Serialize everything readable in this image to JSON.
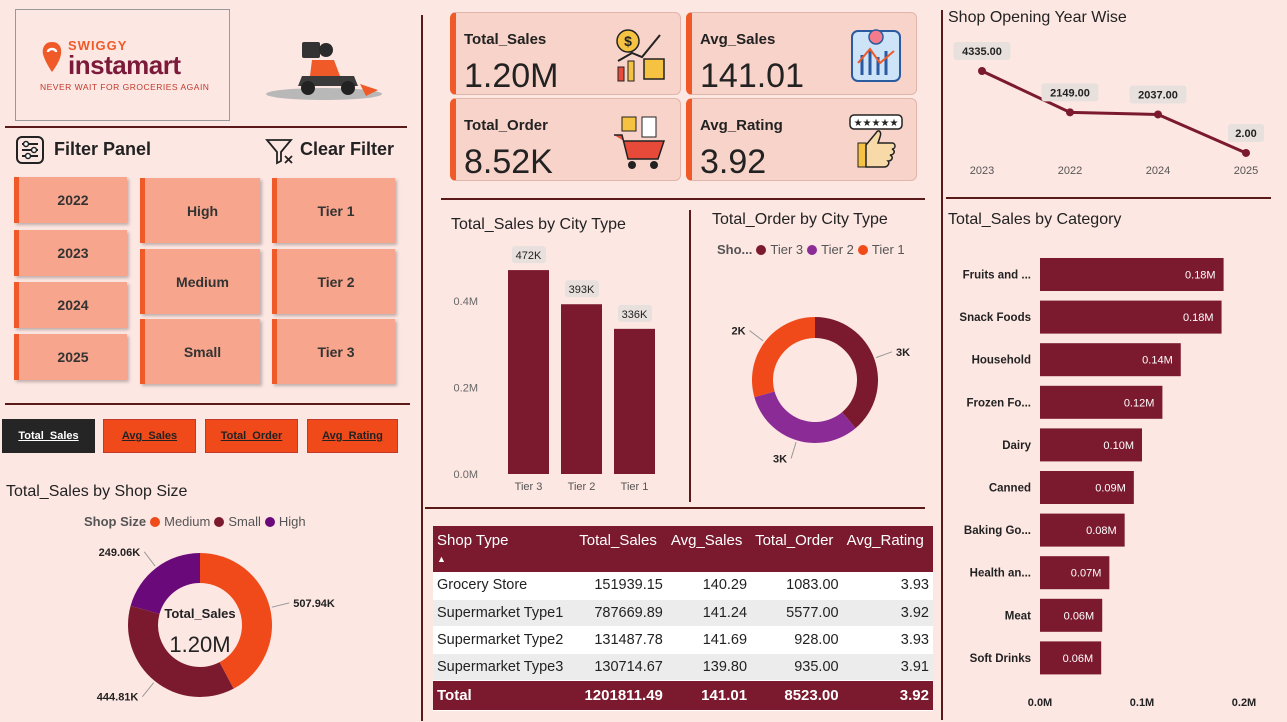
{
  "logo": {
    "brand_small": "SWIGGY",
    "brand_big": "instamart",
    "tagline": "NEVER WAIT FOR GROCERIES AGAIN"
  },
  "filters": {
    "title": "Filter Panel",
    "clear_label": "Clear Filter",
    "years": [
      "2022",
      "2023",
      "2024",
      "2025"
    ],
    "sizes": [
      "High",
      "Medium",
      "Small"
    ],
    "tiers": [
      "Tier 1",
      "Tier 2",
      "Tier 3"
    ]
  },
  "metric_tabs": [
    "Total_Sales",
    "Avg_Sales",
    "Total_Order",
    "Avg_Rating"
  ],
  "kpis": [
    {
      "label": "Total_Sales",
      "value": "1.20M",
      "icon": "money-growth-icon"
    },
    {
      "label": "Avg_Sales",
      "value": "141.01",
      "icon": "analytics-icon"
    },
    {
      "label": "Total_Order",
      "value": "8.52K",
      "icon": "shopping-cart-icon"
    },
    {
      "label": "Avg_Rating",
      "value": "3.92",
      "icon": "thumbs-up-rating-icon"
    }
  ],
  "shop_size_chart": {
    "title": "Total_Sales by Shop Size",
    "legend_title": "Shop Size",
    "center_label": "Total_Sales",
    "center_value": "1.20M",
    "chart_data": {
      "type": "pie",
      "series": [
        {
          "name": "Medium",
          "value": 507.94,
          "label": "507.94K",
          "color": "#f04a1a"
        },
        {
          "name": "Small",
          "value": 444.81,
          "label": "444.81K",
          "color": "#7b1a2e"
        },
        {
          "name": "High",
          "value": 249.06,
          "label": "249.06K",
          "color": "#6a0a7a"
        }
      ]
    }
  },
  "city_sales_chart": {
    "title": "Total_Sales by City Type",
    "chart_data": {
      "type": "bar",
      "categories": [
        "Tier 3",
        "Tier 2",
        "Tier 1"
      ],
      "values": [
        472,
        393,
        336
      ],
      "value_labels": [
        "472K",
        "393K",
        "336K"
      ],
      "y_ticks": [
        "0.0M",
        "0.2M",
        "0.4M"
      ],
      "ylim": [
        0,
        500
      ],
      "color": "#7b1a2e"
    }
  },
  "city_order_chart": {
    "title": "Total_Order by City Type",
    "legend_title": "Sho...",
    "chart_data": {
      "type": "pie",
      "series": [
        {
          "name": "Tier 3",
          "value": 3.3,
          "label": "3K",
          "color": "#7b1a2e"
        },
        {
          "name": "Tier 2",
          "value": 2.7,
          "label": "3K",
          "color": "#8b2c96"
        },
        {
          "name": "Tier 1",
          "value": 2.5,
          "label": "2K",
          "color": "#f04a1a"
        }
      ]
    }
  },
  "shop_table": {
    "columns": [
      "Shop Type",
      "Total_Sales",
      "Avg_Sales",
      "Total_Order",
      "Avg_Rating"
    ],
    "rows": [
      [
        "Grocery Store",
        "151939.15",
        "140.29",
        "1083.00",
        "3.93"
      ],
      [
        "Supermarket Type1",
        "787669.89",
        "141.24",
        "5577.00",
        "3.92"
      ],
      [
        "Supermarket Type2",
        "131487.78",
        "141.69",
        "928.00",
        "3.93"
      ],
      [
        "Supermarket Type3",
        "130714.67",
        "139.80",
        "935.00",
        "3.91"
      ]
    ],
    "total": [
      "Total",
      "1201811.49",
      "141.01",
      "8523.00",
      "3.92"
    ]
  },
  "year_chart": {
    "title": "Shop Opening Year Wise",
    "chart_data": {
      "type": "line",
      "categories": [
        "2023",
        "2022",
        "2024",
        "2025"
      ],
      "values": [
        4335,
        2149,
        2037,
        2
      ],
      "value_labels": [
        "4335.00",
        "2149.00",
        "2037.00",
        "2.00"
      ],
      "color": "#7b1a2e"
    }
  },
  "category_chart": {
    "title": "Total_Sales by Category",
    "chart_data": {
      "type": "bar",
      "orientation": "horizontal",
      "categories": [
        "Fruits and ...",
        "Snack Foods",
        "Household",
        "Frozen Fo...",
        "Dairy",
        "Canned",
        "Baking Go...",
        "Health an...",
        "Meat",
        "Soft Drinks"
      ],
      "values": [
        0.18,
        0.178,
        0.138,
        0.12,
        0.1,
        0.092,
        0.083,
        0.068,
        0.061,
        0.06
      ],
      "value_labels": [
        "0.18M",
        "0.18M",
        "0.14M",
        "0.12M",
        "0.10M",
        "0.09M",
        "0.08M",
        "0.07M",
        "0.06M",
        "0.06M"
      ],
      "x_ticks": [
        "0.0M",
        "0.1M",
        "0.2M"
      ],
      "xlim": [
        0,
        0.2
      ],
      "color": "#7b1a2e"
    }
  }
}
